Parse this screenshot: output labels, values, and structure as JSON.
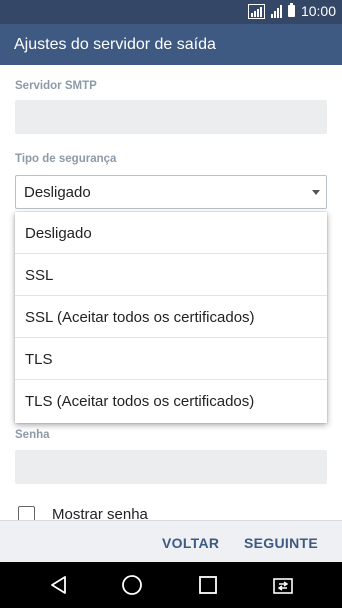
{
  "status_bar": {
    "time": "10:00",
    "signal_label": "4G"
  },
  "app_bar": {
    "title": "Ajustes do servidor de saída"
  },
  "smtp": {
    "label": "Servidor SMTP",
    "value": ""
  },
  "security": {
    "label": "Tipo de segurança",
    "selected": "Desligado",
    "options": [
      "Desligado",
      "SSL",
      "SSL (Aceitar todos os certificados)",
      "TLS",
      "TLS (Aceitar todos os certificados)"
    ]
  },
  "password": {
    "label": "Senha",
    "value": ""
  },
  "show_password": {
    "label": "Mostrar senha",
    "checked": false
  },
  "actions": {
    "back": "VOLTAR",
    "next": "SEGUINTE"
  },
  "nav": {
    "back_icon": "back-triangle-icon",
    "home_icon": "home-circle-icon",
    "recents_icon": "recents-square-icon",
    "switch_icon": "dual-window-icon"
  },
  "colors": {
    "status_bar": "#344767",
    "app_bar": "#3e5a82",
    "accent": "#3e5a82"
  }
}
